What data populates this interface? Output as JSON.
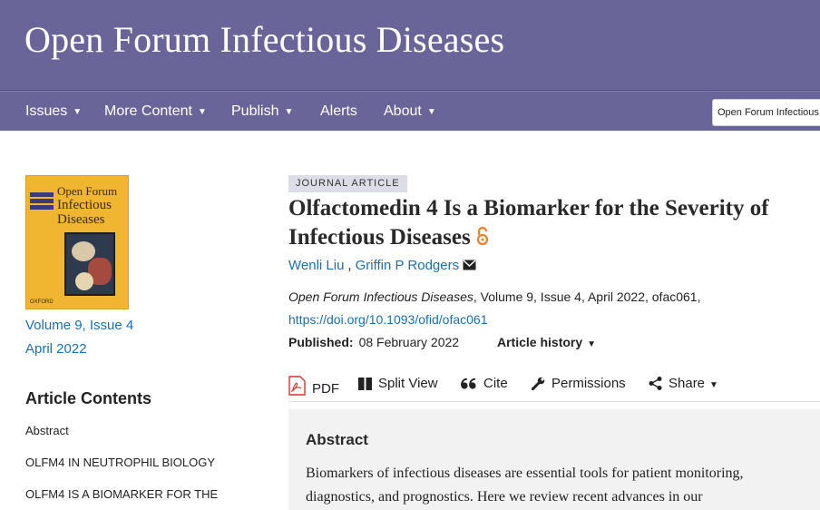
{
  "header": {
    "journal_title": "Open Forum Infectious Diseases"
  },
  "nav": {
    "items": [
      {
        "label": "Issues",
        "has_dropdown": true
      },
      {
        "label": "More Content",
        "has_dropdown": true
      },
      {
        "label": "Publish",
        "has_dropdown": true
      },
      {
        "label": "Alerts",
        "has_dropdown": false
      },
      {
        "label": "About",
        "has_dropdown": true
      }
    ],
    "journal_select_value": "Open Forum Infectious"
  },
  "cover": {
    "title_line1": "Open Forum",
    "title_line2": "Infectious",
    "title_line3": "Diseases",
    "publisher": "OXFORD",
    "background_color": "#f0b531"
  },
  "sidebar": {
    "volume_issue": "Volume 9, Issue 4",
    "issue_date": "April 2022",
    "contents_heading": "Article Contents",
    "contents_items": [
      "Abstract",
      "OLFM4 IN NEUTROPHIL BIOLOGY",
      "OLFM4 IS A BIOMARKER FOR THE"
    ]
  },
  "article": {
    "type_badge": "JOURNAL ARTICLE",
    "title_line1": "Olfactomedin 4 Is a Biomarker for the Severity of",
    "title_line2": "Infectious Diseases",
    "open_access_icon": "open-access-icon",
    "authors": [
      "Wenli Liu",
      "Griffin P Rodgers"
    ],
    "author_separator": ",",
    "citation_journal": "Open Forum Infectious Diseases",
    "citation_rest": ", Volume 9, Issue 4, April 2022, ofac061,",
    "doi": "https://doi.org/10.1093/ofid/ofac061",
    "published_label": "Published:",
    "published_date": "08 February 2022",
    "history_label": "Article history"
  },
  "toolbar": {
    "pdf": "PDF",
    "split_view": "Split View",
    "cite": "Cite",
    "permissions": "Permissions",
    "share": "Share"
  },
  "abstract": {
    "heading": "Abstract",
    "line1": "Biomarkers of infectious diseases are essential tools for patient monitoring,",
    "line2": "diagnostics, and prognostics. Here we review recent advances in our"
  },
  "colors": {
    "brand_purple": "#6a6598",
    "link_blue": "#1a6fb5",
    "open_access_orange": "#f07f2a",
    "pdf_red": "#d9342b"
  }
}
